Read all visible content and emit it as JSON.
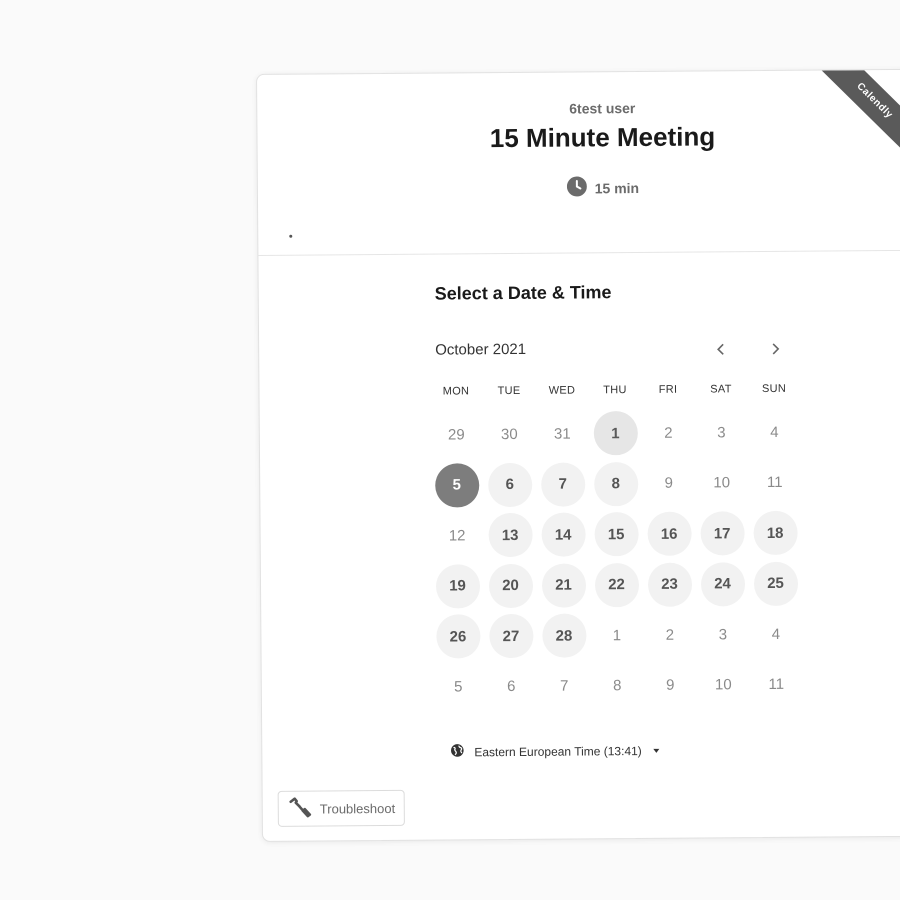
{
  "ribbon": {
    "text": "Calendly"
  },
  "header": {
    "owner": "6test user",
    "event_title": "15 Minute Meeting",
    "duration": "15 min",
    "icon": "clock-icon"
  },
  "picker": {
    "title": "Select a Date & Time",
    "month": "October 2021",
    "weekdays": [
      "MON",
      "TUE",
      "WED",
      "THU",
      "FRI",
      "SAT",
      "SUN"
    ],
    "days": [
      {
        "label": "29",
        "state": "muted"
      },
      {
        "label": "30",
        "state": "muted"
      },
      {
        "label": "31",
        "state": "muted"
      },
      {
        "label": "1",
        "state": "today"
      },
      {
        "label": "2",
        "state": "muted"
      },
      {
        "label": "3",
        "state": "muted"
      },
      {
        "label": "4",
        "state": "muted"
      },
      {
        "label": "5",
        "state": "selected"
      },
      {
        "label": "6",
        "state": "available"
      },
      {
        "label": "7",
        "state": "available"
      },
      {
        "label": "8",
        "state": "available"
      },
      {
        "label": "9",
        "state": "muted"
      },
      {
        "label": "10",
        "state": "muted"
      },
      {
        "label": "11",
        "state": "muted"
      },
      {
        "label": "12",
        "state": "muted"
      },
      {
        "label": "13",
        "state": "available"
      },
      {
        "label": "14",
        "state": "available"
      },
      {
        "label": "15",
        "state": "available"
      },
      {
        "label": "16",
        "state": "available"
      },
      {
        "label": "17",
        "state": "available"
      },
      {
        "label": "18",
        "state": "available"
      },
      {
        "label": "19",
        "state": "available"
      },
      {
        "label": "20",
        "state": "available"
      },
      {
        "label": "21",
        "state": "available"
      },
      {
        "label": "22",
        "state": "available"
      },
      {
        "label": "23",
        "state": "available"
      },
      {
        "label": "24",
        "state": "available"
      },
      {
        "label": "25",
        "state": "available"
      },
      {
        "label": "26",
        "state": "available"
      },
      {
        "label": "27",
        "state": "available"
      },
      {
        "label": "28",
        "state": "available"
      },
      {
        "label": "1",
        "state": "muted"
      },
      {
        "label": "2",
        "state": "muted"
      },
      {
        "label": "3",
        "state": "muted"
      },
      {
        "label": "4",
        "state": "muted"
      },
      {
        "label": "5",
        "state": "muted"
      },
      {
        "label": "6",
        "state": "muted"
      },
      {
        "label": "7",
        "state": "muted"
      },
      {
        "label": "8",
        "state": "muted"
      },
      {
        "label": "9",
        "state": "muted"
      },
      {
        "label": "10",
        "state": "muted"
      },
      {
        "label": "11",
        "state": "muted"
      }
    ]
  },
  "timezone": {
    "label": "Eastern European Time (13:41)",
    "icon": "globe-icon"
  },
  "troubleshoot": {
    "label": "Troubleshoot",
    "icon": "wrench-icon"
  },
  "colors": {
    "selected": "#7d7d7d",
    "available_bg": "#f2f2f2",
    "ribbon": "#5a5a5a"
  }
}
